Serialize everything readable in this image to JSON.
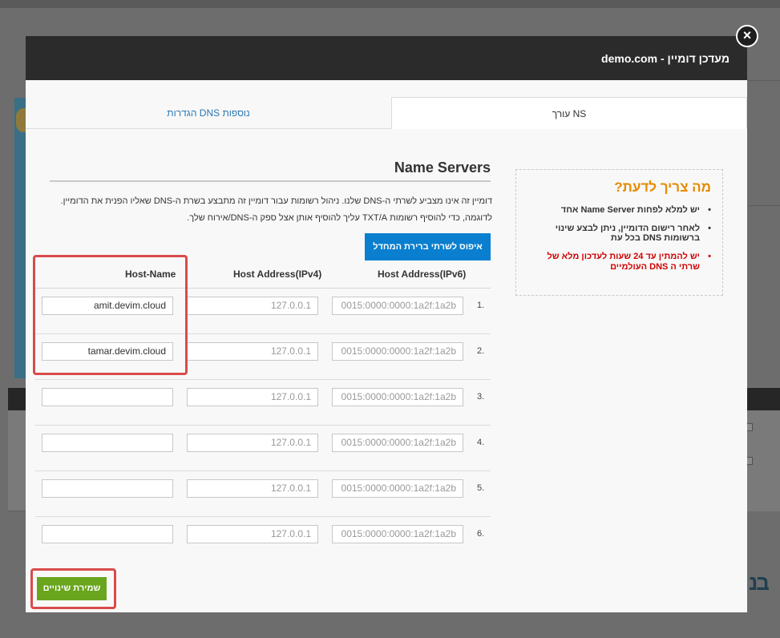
{
  "modal": {
    "title": "מעדכן דומיין - demo.com",
    "close_glyph": "×"
  },
  "tabs": [
    {
      "label": "עורך NS",
      "active": true
    },
    {
      "label": "הגדרות DNS נוספות",
      "active": false
    }
  ],
  "info": {
    "title": "מה צריך לדעת?",
    "items": [
      "יש למלא לפחות Name Server אחד",
      "לאחר רישום הדומיין, ניתן לבצע שינוי ברשומות DNS בכל עת",
      "יש להמתין עד 24 שעות לעדכון מלא של שרתי ה DNS העולמיים"
    ]
  },
  "ns": {
    "title": "Name Servers",
    "desc_line1": "דומיין זה אינו מצביע לשרתי ה-DNS שלנו. ניהול רשומות עבור דומיין זה מתבצע בשרת ה-DNS שאליו הפנית את הדומיין.",
    "desc_line2": "לדוגמה, כדי להוסיף רשומות TXT/A עליך להוסיף אותן אצל ספק ה-DNS/אירוח שלך.",
    "reset_label": "איפוס לשרתי ברירת המחדל",
    "columns": {
      "host": "Host-Name",
      "ipv4": "Host Address(IPv4)",
      "ipv6": "Host Address(IPv6)"
    },
    "rows": [
      {
        "num": "1.",
        "host": "amit.devim.cloud",
        "ipv4": "127.0.0.1",
        "ipv6": "0015:0000:0000:1a2f:1a2b"
      },
      {
        "num": "2.",
        "host": "tamar.devim.cloud",
        "ipv4": "127.0.0.1",
        "ipv6": "0015:0000:0000:1a2f:1a2b"
      },
      {
        "num": "3.",
        "host": "",
        "ipv4": "127.0.0.1",
        "ipv6": "0015:0000:0000:1a2f:1a2b"
      },
      {
        "num": "4.",
        "host": "",
        "ipv4": "127.0.0.1",
        "ipv6": "0015:0000:0000:1a2f:1a2b"
      },
      {
        "num": "5.",
        "host": "",
        "ipv4": "127.0.0.1",
        "ipv6": "0015:0000:0000:1a2f:1a2b"
      },
      {
        "num": "6.",
        "host": "",
        "ipv4": "127.0.0.1",
        "ipv6": "0015:0000:0000:1a2f:1a2b"
      }
    ],
    "save_label": "שמירת שינויים"
  },
  "colors": {
    "header_bg": "#2b2b2b",
    "accent_blue": "#0a7fcf",
    "save_green": "#69a51d",
    "warn_red": "#d00000",
    "info_orange": "#e68a00",
    "highlight_red": "#d94b4b"
  }
}
